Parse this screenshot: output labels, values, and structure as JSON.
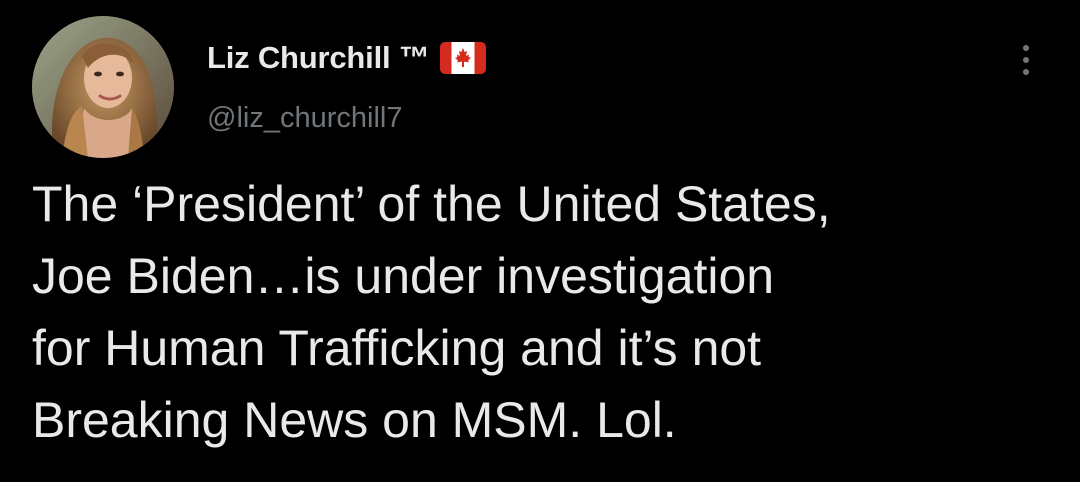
{
  "colors": {
    "background": "#000000",
    "primary_text": "#e7e9ea",
    "secondary_text": "#71767b",
    "flag_red": "#d52b1e"
  },
  "author": {
    "display_name": "Liz Churchill ™",
    "handle": "@liz_churchill7",
    "badge_icon": "canada-flag-icon",
    "avatar_icon": "profile-avatar"
  },
  "more_menu": {
    "icon": "more-vertical-icon"
  },
  "tweet": {
    "lines": [
      "The ‘President’ of the United States,",
      "Joe Biden…is under investigation",
      "for Human Trafficking and it’s not",
      "Breaking News on MSM. Lol."
    ]
  }
}
